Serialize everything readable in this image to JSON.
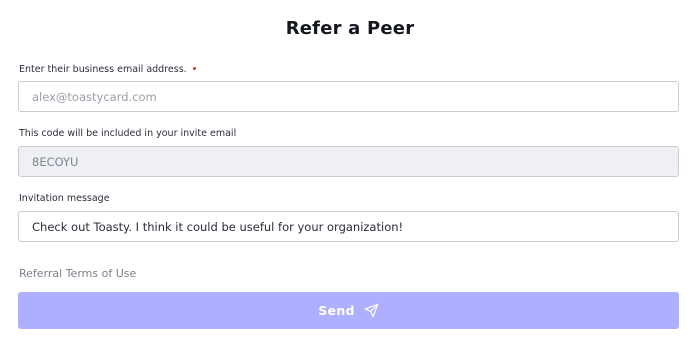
{
  "form": {
    "title": "Refer a Peer",
    "email": {
      "label": "Enter their business email address.",
      "placeholder": "alex@toastycard.com",
      "value": ""
    },
    "code": {
      "label": "This code will be included in your invite email",
      "value": "8ECOYU"
    },
    "message": {
      "label": "Invitation message",
      "value": "Check out Toasty. I think it could be useful for your organization!"
    },
    "terms_link": "Referral Terms of Use",
    "send_label": "Send",
    "send_icon": "paper-plane-icon"
  },
  "colors": {
    "required": "#e02d2d",
    "button": "#aeb0ff",
    "readonly_bg": "#eff0f4"
  }
}
